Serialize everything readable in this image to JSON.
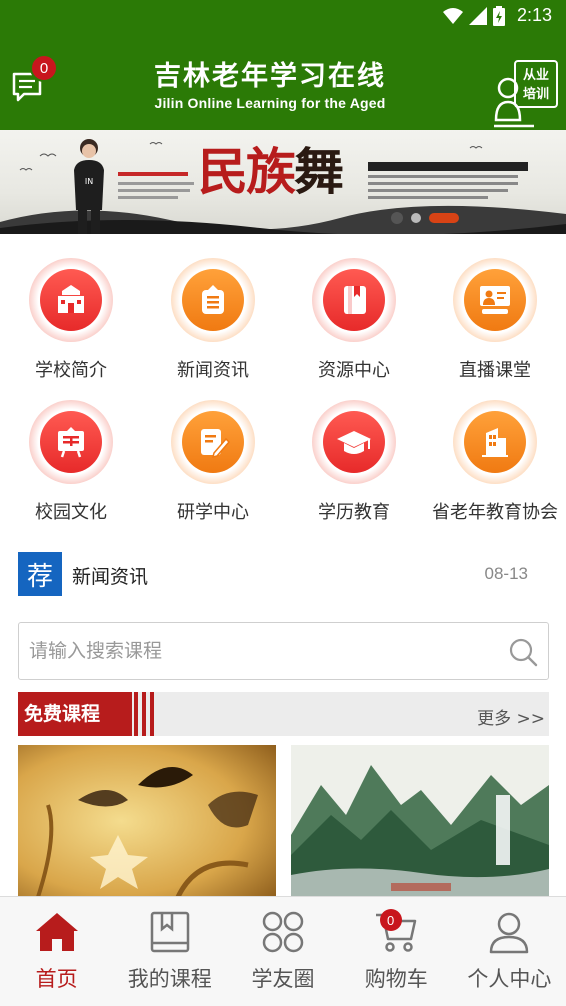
{
  "status_bar": {
    "time": "2:13",
    "icons": [
      "wifi-icon",
      "cellular-icon",
      "battery-icon"
    ]
  },
  "header": {
    "title_cn": "吉林老年学习在线",
    "title_en": "Jilin Online Learning for the Aged",
    "message_badge": "0",
    "training_button": {
      "line1": "从业",
      "line2": "培训"
    }
  },
  "banner": {
    "title": "民族舞",
    "slides": 3,
    "active_slide": 2
  },
  "categories": [
    {
      "label": "学校简介",
      "icon": "school-icon",
      "color": "red"
    },
    {
      "label": "新闻资讯",
      "icon": "news-icon",
      "color": "orange"
    },
    {
      "label": "资源中心",
      "icon": "book-icon",
      "color": "red"
    },
    {
      "label": "直播课堂",
      "icon": "live-class-icon",
      "color": "orange"
    },
    {
      "label": "校园文化",
      "icon": "culture-icon",
      "color": "red"
    },
    {
      "label": "研学中心",
      "icon": "study-icon",
      "color": "orange"
    },
    {
      "label": "学历教育",
      "icon": "graduation-cap-icon",
      "color": "red"
    },
    {
      "label": "省老年教育协会",
      "icon": "building-icon",
      "color": "orange"
    }
  ],
  "news": {
    "badge": "荐",
    "text": "新闻资讯",
    "date": "08-13"
  },
  "search": {
    "placeholder": "请输入搜索课程"
  },
  "free_courses": {
    "title": "免费课程",
    "more": "更多 >>"
  },
  "tabbar": {
    "items": [
      {
        "label": "首页",
        "icon": "home-icon",
        "active": true
      },
      {
        "label": "我的课程",
        "icon": "my-courses-icon",
        "active": false
      },
      {
        "label": "学友圈",
        "icon": "circle-icon",
        "active": false
      },
      {
        "label": "购物车",
        "icon": "cart-icon",
        "active": false,
        "badge": "0"
      },
      {
        "label": "个人中心",
        "icon": "profile-icon",
        "active": false
      }
    ]
  },
  "colors": {
    "header_green": "#2b7a06",
    "accent_red": "#b71c1c",
    "badge_red": "#c8161d",
    "icon_red": "#e72a2a",
    "icon_orange": "#f07a12",
    "recommend_blue": "#1565c0"
  }
}
